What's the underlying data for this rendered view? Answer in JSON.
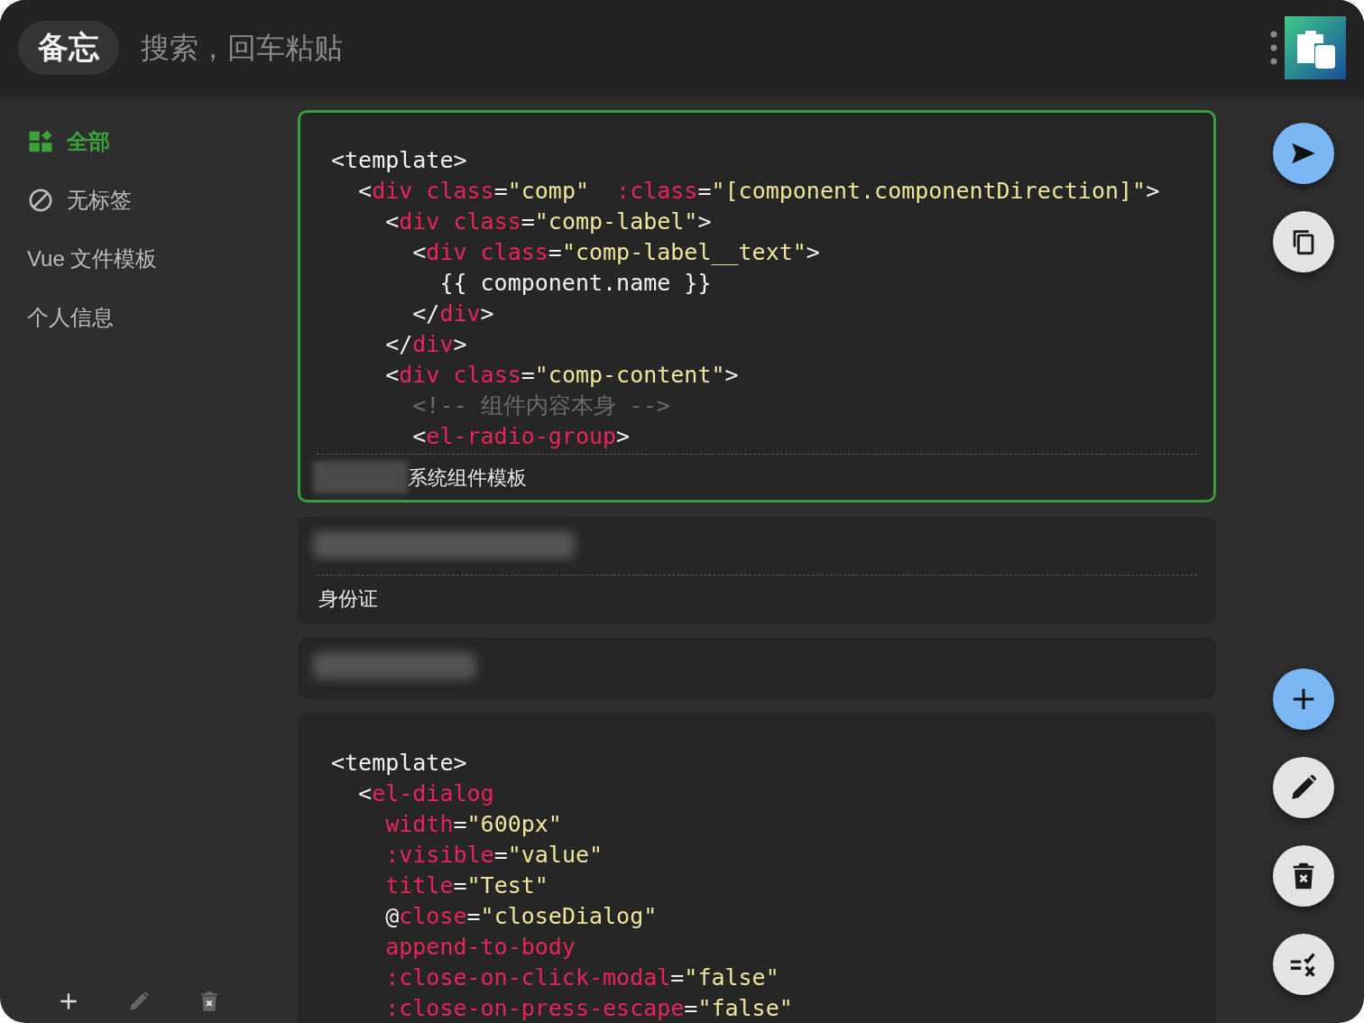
{
  "header": {
    "title": "备忘",
    "search": {
      "placeholder": "搜索，回车粘贴"
    }
  },
  "sidebar": {
    "items": [
      {
        "kind": "all",
        "label": "全部",
        "selected": true
      },
      {
        "kind": "untagged",
        "label": "无标签",
        "selected": false
      },
      {
        "kind": "tag",
        "label": "Vue 文件模板",
        "selected": false
      },
      {
        "kind": "tag",
        "label": "个人信息",
        "selected": false
      }
    ],
    "toolbar": [
      {
        "kind": "add",
        "disabled": false
      },
      {
        "kind": "edit",
        "disabled": true
      },
      {
        "kind": "delete",
        "disabled": true
      }
    ]
  },
  "cards": [
    {
      "selected": true,
      "code": [
        [
          {
            "kind": "punct",
            "text": "<template>"
          }
        ],
        [
          {
            "kind": "punct",
            "text": "  <"
          },
          {
            "kind": "tag",
            "text": "div"
          },
          {
            "kind": "attr",
            "text": " class"
          },
          {
            "kind": "punct",
            "text": "="
          },
          {
            "kind": "string",
            "text": "\"comp\""
          },
          {
            "kind": "attr",
            "text": "  :class"
          },
          {
            "kind": "punct",
            "text": "="
          },
          {
            "kind": "string",
            "text": "\"[component.componentDirection]\""
          },
          {
            "kind": "punct",
            "text": ">"
          }
        ],
        [
          {
            "kind": "punct",
            "text": "    <"
          },
          {
            "kind": "tag",
            "text": "div"
          },
          {
            "kind": "attr",
            "text": " class"
          },
          {
            "kind": "punct",
            "text": "="
          },
          {
            "kind": "string",
            "text": "\"comp-label\""
          },
          {
            "kind": "punct",
            "text": ">"
          }
        ],
        [
          {
            "kind": "punct",
            "text": "      <"
          },
          {
            "kind": "tag",
            "text": "div"
          },
          {
            "kind": "attr",
            "text": " class"
          },
          {
            "kind": "punct",
            "text": "="
          },
          {
            "kind": "string",
            "text": "\"comp-label__text\""
          },
          {
            "kind": "punct",
            "text": ">"
          }
        ],
        [
          {
            "kind": "punct",
            "text": "        {{ component.name }}"
          }
        ],
        [
          {
            "kind": "punct",
            "text": "      </"
          },
          {
            "kind": "tag",
            "text": "div"
          },
          {
            "kind": "punct",
            "text": ">"
          }
        ],
        [
          {
            "kind": "punct",
            "text": "    </"
          },
          {
            "kind": "tag",
            "text": "div"
          },
          {
            "kind": "punct",
            "text": ">"
          }
        ],
        [
          {
            "kind": "punct",
            "text": "    <"
          },
          {
            "kind": "tag",
            "text": "div"
          },
          {
            "kind": "attr",
            "text": " class"
          },
          {
            "kind": "punct",
            "text": "="
          },
          {
            "kind": "string",
            "text": "\"comp-content\""
          },
          {
            "kind": "punct",
            "text": ">"
          }
        ],
        [
          {
            "kind": "comment",
            "text": "      <!-- 组件内容本身 -->"
          }
        ],
        [
          {
            "kind": "punct",
            "text": "      <"
          },
          {
            "kind": "tag",
            "text": "el-radio-group"
          },
          {
            "kind": "punct",
            "text": ">"
          }
        ]
      ],
      "redacted": true,
      "tag": "系统组件模板"
    },
    {
      "selected": false,
      "redacted_text": true,
      "tag": "身份证"
    },
    {
      "selected": false,
      "redacted_text": true
    },
    {
      "selected": false,
      "code": [
        [
          {
            "kind": "punct",
            "text": "<template>"
          }
        ],
        [
          {
            "kind": "punct",
            "text": "  <"
          },
          {
            "kind": "tag",
            "text": "el-dialog"
          }
        ],
        [
          {
            "kind": "attr",
            "text": "    width"
          },
          {
            "kind": "punct",
            "text": "="
          },
          {
            "kind": "string",
            "text": "\"600px\""
          }
        ],
        [
          {
            "kind": "attr",
            "text": "    :visible"
          },
          {
            "kind": "punct",
            "text": "="
          },
          {
            "kind": "string",
            "text": "\"value\""
          }
        ],
        [
          {
            "kind": "attr",
            "text": "    title"
          },
          {
            "kind": "punct",
            "text": "="
          },
          {
            "kind": "string",
            "text": "\"Test\""
          }
        ],
        [
          {
            "kind": "punct",
            "text": "    @"
          },
          {
            "kind": "attr",
            "text": "close"
          },
          {
            "kind": "punct",
            "text": "="
          },
          {
            "kind": "string",
            "text": "\"closeDialog\""
          }
        ],
        [
          {
            "kind": "attr",
            "text": "    append-to-body"
          }
        ],
        [
          {
            "kind": "attr",
            "text": "    :close-on-click-modal"
          },
          {
            "kind": "punct",
            "text": "="
          },
          {
            "kind": "string",
            "text": "\"false\""
          }
        ],
        [
          {
            "kind": "attr",
            "text": "    :close-on-press-escape"
          },
          {
            "kind": "punct",
            "text": "="
          },
          {
            "kind": "string",
            "text": "\"false\""
          }
        ]
      ]
    }
  ],
  "actions_top": [
    {
      "kind": "send",
      "primary": true
    },
    {
      "kind": "copy",
      "primary": false
    }
  ],
  "actions_bottom": [
    {
      "kind": "add",
      "primary": true
    },
    {
      "kind": "edit",
      "primary": false
    },
    {
      "kind": "delete",
      "primary": false
    },
    {
      "kind": "clear",
      "primary": false
    }
  ]
}
